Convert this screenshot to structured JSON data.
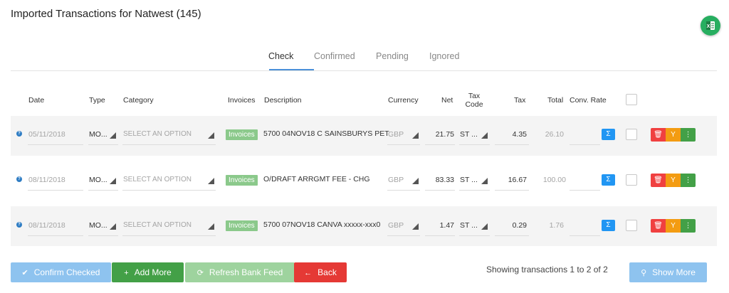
{
  "page": {
    "title": "Imported Transactions for Natwest (145)"
  },
  "export": {
    "icon": "excel-icon"
  },
  "tabs": [
    {
      "label": "Check",
      "active": true
    },
    {
      "label": "Confirmed",
      "active": false
    },
    {
      "label": "Pending",
      "active": false
    },
    {
      "label": "Ignored",
      "active": false
    }
  ],
  "columns": {
    "date": "Date",
    "type": "Type",
    "category": "Category",
    "invoices": "Invoices",
    "description": "Description",
    "currency": "Currency",
    "net": "Net",
    "tax_code_1": "Tax",
    "tax_code_2": "Code",
    "tax": "Tax",
    "total": "Total",
    "conv_rate": "Conv. Rate"
  },
  "rows": [
    {
      "date": "05/11/2018",
      "type": "MO...",
      "category": "SELECT AN OPTION",
      "invoices": "Invoices",
      "description": "5700 04NOV18 C SAINSBURYS PET",
      "currency": "GBP",
      "net": "21.75",
      "tax_code": "ST ...",
      "tax": "4.35",
      "total": "26.10",
      "conv_rate": "",
      "conv_label": "Σ"
    },
    {
      "date": "08/11/2018",
      "type": "MO...",
      "category": "SELECT AN OPTION",
      "invoices": "Invoices",
      "description": "O/DRAFT ARRGMT FEE - CHG",
      "currency": "GBP",
      "net": "83.33",
      "tax_code": "ST ...",
      "tax": "16.67",
      "total": "100.00",
      "conv_rate": "",
      "conv_label": "Σ"
    },
    {
      "date": "08/11/2018",
      "type": "MO...",
      "category": "SELECT AN OPTION",
      "invoices": "Invoices",
      "description": "5700 07NOV18 CANVA xxxxx-xxx0",
      "currency": "GBP",
      "net": "1.47",
      "tax_code": "ST ...",
      "tax": "0.29",
      "total": "1.76",
      "conv_rate": "",
      "conv_label": "Σ"
    }
  ],
  "footer": {
    "confirm_checked": "Confirm Checked",
    "add_more": "Add More",
    "refresh_bank_feed": "Refresh Bank Feed",
    "back": "Back",
    "showing": "Showing transactions 1 to 2 of 2",
    "show_more": "Show More"
  },
  "colors": {
    "accent": "#4a90d9",
    "confirm": "#8ec3ef",
    "add": "#43a047",
    "refresh": "#9ed39e",
    "back": "#e53935",
    "invoices_badge": "#8bc98b",
    "delete": "#f04040",
    "split": "#f39c12",
    "more": "#43a047"
  }
}
